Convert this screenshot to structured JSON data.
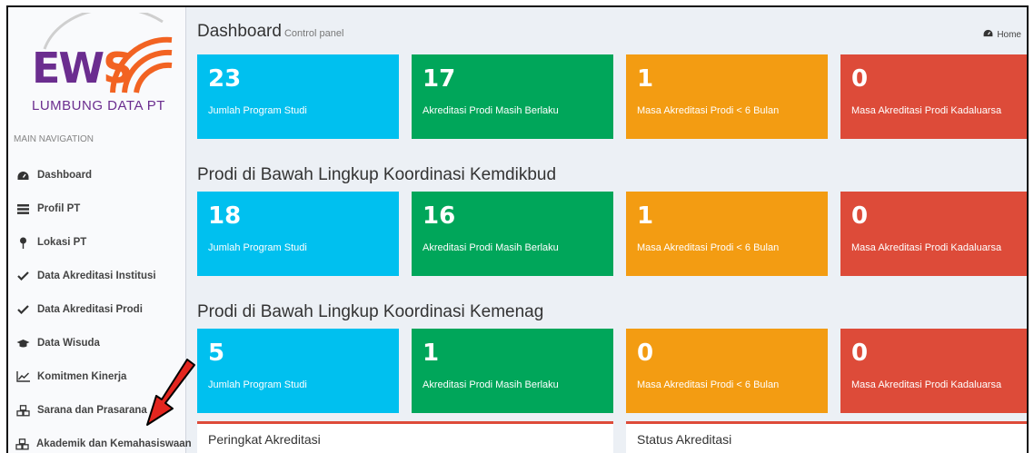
{
  "logo": {
    "main": "EWS",
    "sub": "LUMBUNG DATA PT"
  },
  "sidebar": {
    "header": "MAIN NAVIGATION",
    "items": [
      {
        "label": "Dashboard",
        "icon": "dashboard-icon"
      },
      {
        "label": "Profil PT",
        "icon": "list-icon"
      },
      {
        "label": "Lokasi PT",
        "icon": "map-marker-icon"
      },
      {
        "label": "Data Akreditasi Institusi",
        "icon": "check-icon"
      },
      {
        "label": "Data Akreditasi Prodi",
        "icon": "check-icon"
      },
      {
        "label": "Data Wisuda",
        "icon": "graduation-cap-icon"
      },
      {
        "label": "Komitmen Kinerja",
        "icon": "line-chart-icon"
      },
      {
        "label": "Sarana dan Prasarana",
        "icon": "cubes-icon"
      },
      {
        "label": "Akademik dan Kemahasiswaan",
        "icon": "cubes-icon"
      }
    ]
  },
  "header": {
    "title": "Dashboard",
    "subtitle": "Control panel",
    "breadcrumb": "Home"
  },
  "sections": [
    {
      "title": "",
      "boxes": [
        {
          "value": "23",
          "label": "Jumlah Program Studi",
          "color": "#00c0ef"
        },
        {
          "value": "17",
          "label": "Akreditasi Prodi Masih Berlaku",
          "color": "#00a65a"
        },
        {
          "value": "1",
          "label": "Masa Akreditasi Prodi < 6 Bulan",
          "color": "#f39c12"
        },
        {
          "value": "0",
          "label": "Masa Akreditasi Prodi Kadaluarsa",
          "color": "#dd4b39"
        }
      ]
    },
    {
      "title": "Prodi di Bawah Lingkup Koordinasi Kemdikbud",
      "boxes": [
        {
          "value": "18",
          "label": "Jumlah Program Studi",
          "color": "#00c0ef"
        },
        {
          "value": "16",
          "label": "Akreditasi Prodi Masih Berlaku",
          "color": "#00a65a"
        },
        {
          "value": "1",
          "label": "Masa Akreditasi Prodi < 6 Bulan",
          "color": "#f39c12"
        },
        {
          "value": "0",
          "label": "Masa Akreditasi Prodi Kadaluarsa",
          "color": "#dd4b39"
        }
      ]
    },
    {
      "title": "Prodi di Bawah Lingkup Koordinasi Kemenag",
      "boxes": [
        {
          "value": "5",
          "label": "Jumlah Program Studi",
          "color": "#00c0ef"
        },
        {
          "value": "1",
          "label": "Akreditasi Prodi Masih Berlaku",
          "color": "#00a65a"
        },
        {
          "value": "0",
          "label": "Masa Akreditasi Prodi < 6 Bulan",
          "color": "#f39c12"
        },
        {
          "value": "0",
          "label": "Masa Akreditasi Prodi Kadaluarsa",
          "color": "#dd4b39"
        }
      ]
    }
  ],
  "panels": [
    {
      "title": "Peringkat Akreditasi"
    },
    {
      "title": "Status Akreditasi"
    }
  ]
}
